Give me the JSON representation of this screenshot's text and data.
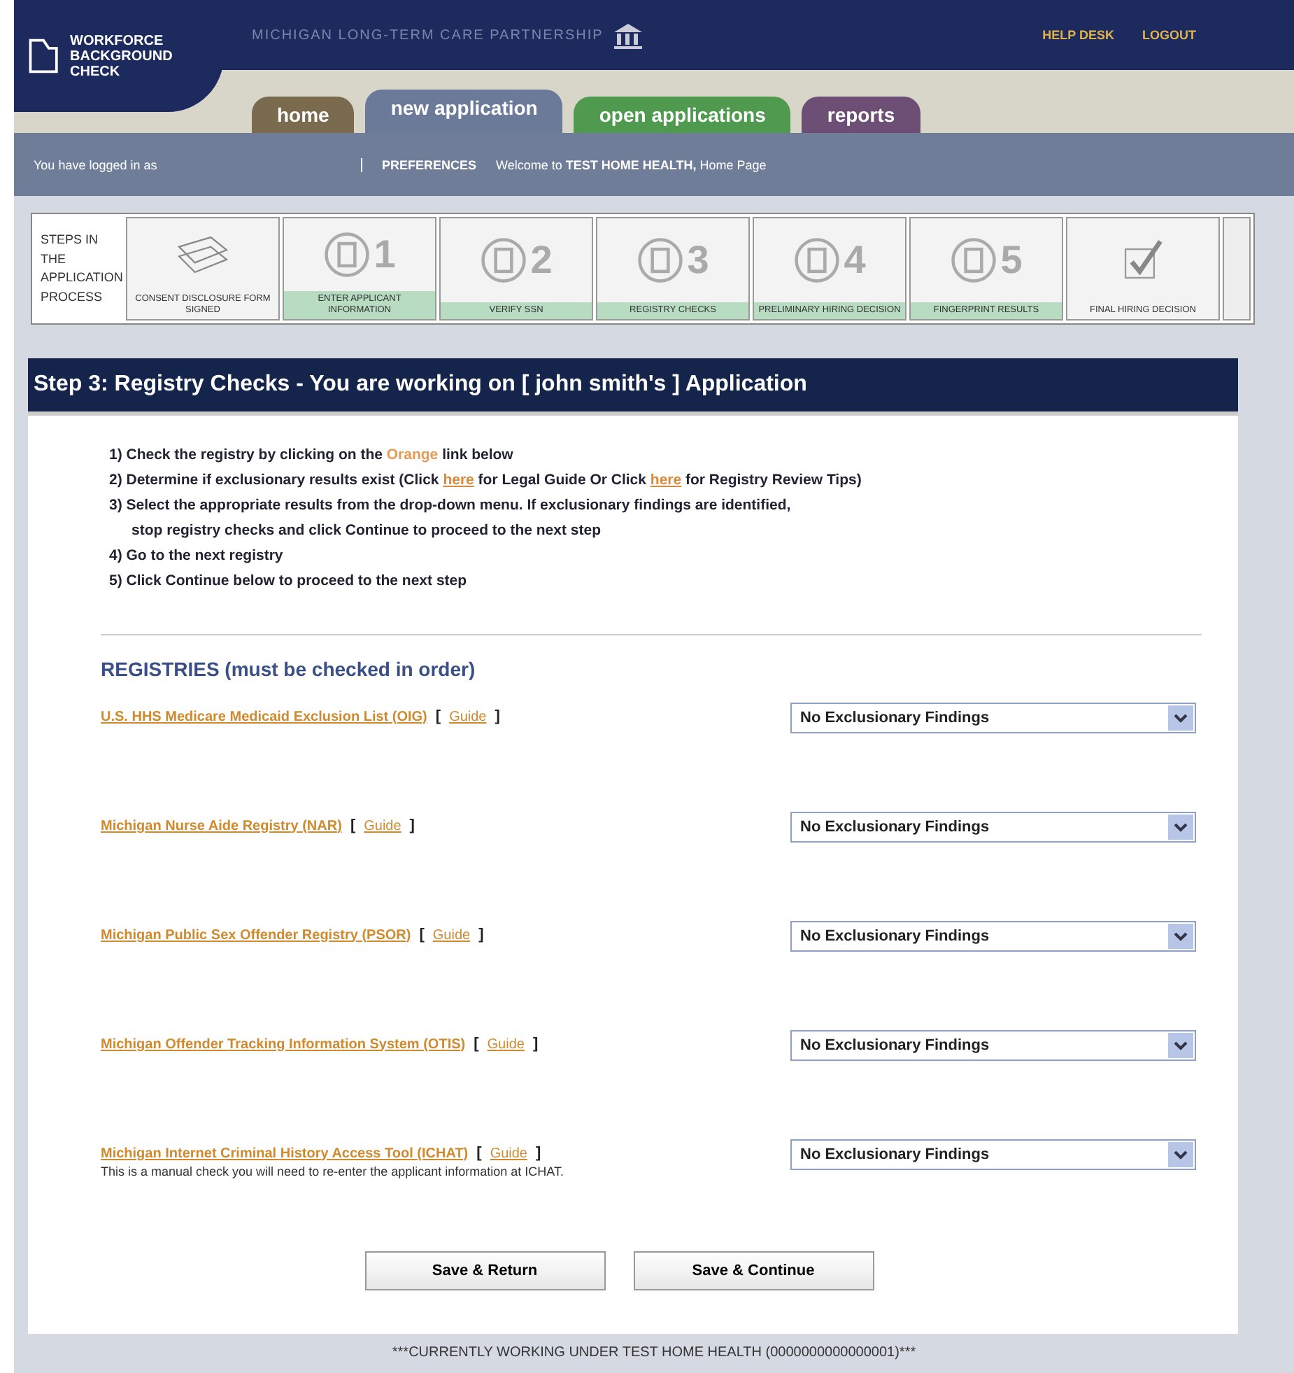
{
  "header": {
    "logo_text": "WORKFORCE BACKGROUND CHECK",
    "partnership": "MICHIGAN LONG-TERM CARE PARTNERSHIP",
    "links": [
      "HELP DESK",
      "LOGOUT"
    ]
  },
  "tabs": [
    {
      "label": "home",
      "selected": false,
      "color": "#7a6a4e"
    },
    {
      "label": "new application",
      "selected": true,
      "color": "#6a7a98"
    },
    {
      "label": "open applications",
      "selected": false,
      "color": "#4f9a4f"
    },
    {
      "label": "reports",
      "selected": false,
      "color": "#6d4e74"
    }
  ],
  "user_bar": {
    "logged_in": "You have logged in as",
    "preferences": "PREFERENCES",
    "welcome": "Welcome to **TEST HOME HEALTH,** Home Page"
  },
  "steps": {
    "title": "STEPS IN THE APPLICATION PROCESS",
    "items": [
      {
        "label": "CONSENT DISCLOSURE FORM SIGNED",
        "completed": false
      },
      {
        "label": "ENTER APPLICANT INFORMATION",
        "number": "1",
        "completed": true
      },
      {
        "label": "VERIFY SSN",
        "number": "2",
        "completed": true
      },
      {
        "label": "REGISTRY CHECKS",
        "number": "3",
        "completed": true
      },
      {
        "label": "PRELIMINARY HIRING DECISION",
        "number": "4",
        "completed": true
      },
      {
        "label": "FINGERPRINT RESULTS",
        "number": "5",
        "completed": true
      },
      {
        "label": "FINAL HIRING DECISION",
        "completed": false
      }
    ]
  },
  "page_title": "Step 3: Registry Checks - You are working on [ john smith's ] Application",
  "instructions": [
    {
      "kind": "plain",
      "text": "1) Check the registry by clicking on the "
    },
    {
      "kind": "plain",
      "text": "2) Determine if exclusionary results exist (Click "
    },
    {
      "kind": "plain",
      "text": "3) Select the appropriate results from the drop-down menu. If exclusionary findings are identified,"
    },
    {
      "kind": "indent",
      "text": "stop registry checks and click Continue to proceed to the next step"
    },
    {
      "kind": "plain",
      "text": "4) Go to the next registry"
    },
    {
      "kind": "plain",
      "text": "5) Click Continue below to proceed to the next step"
    }
  ],
  "instruction_parts": {
    "orange_word": "Orange",
    "link_below": " link below",
    "here_1": "here",
    "legal": " for Legal Guide Or Click ",
    "here_2": "here",
    "tips": " for Registry Review Tips)"
  },
  "registries_heading": "REGISTRIES (must be checked in order)",
  "registries": [
    {
      "name": "U.S. HHS Medicare Medicaid Exclusion List (OIG)",
      "guide": "Guide",
      "finding": "No Exclusionary Findings"
    },
    {
      "name": "Michigan Nurse Aide Registry (NAR)",
      "guide": "Guide",
      "finding": "No Exclusionary Findings"
    },
    {
      "name": "Michigan Public Sex Offender Registry (PSOR)",
      "guide": "Guide",
      "finding": "No Exclusionary Findings"
    },
    {
      "name": "Michigan Offender Tracking Information System (OTIS)",
      "guide": "Guide",
      "finding": "No Exclusionary Findings"
    },
    {
      "name": "Michigan Internet Criminal History Access Tool (ICHAT)",
      "guide": "Guide",
      "finding": "No Exclusionary Findings",
      "note": "This is a manual check you will need to re-enter the applicant information at ICHAT."
    }
  ],
  "bracket_open": "[",
  "bracket_close": "]",
  "buttons": [
    "Save & Return",
    "Save & Continue"
  ],
  "footer": "***CURRENTLY WORKING UNDER TEST HOME HEALTH (0000000000000001)***"
}
